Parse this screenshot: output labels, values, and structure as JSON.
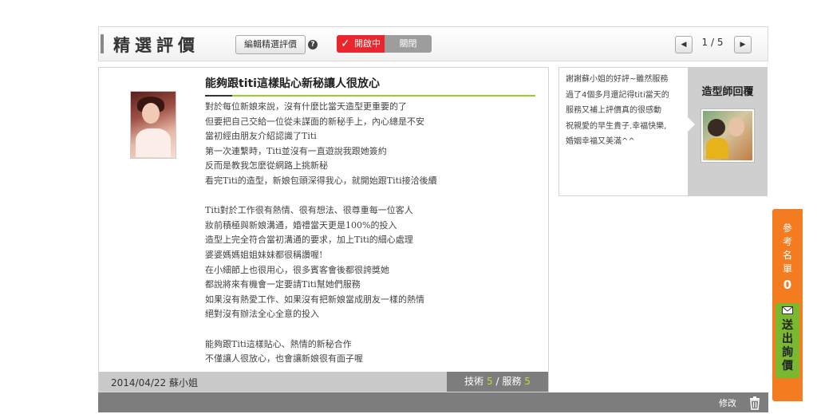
{
  "header": {
    "title": "精選評價",
    "edit_label": "編輯精選評價",
    "help": "?",
    "toggle_on": "開啟中",
    "toggle_off": "關閉",
    "pager": "1 / 5",
    "prev": "◀",
    "next": "▶"
  },
  "review": {
    "title": "能夠跟titi這樣貼心新秘讓人很放心",
    "lines": [
      "對於每位新娘來說，沒有什麼比當天造型更重要的了",
      "但要把自己交給一位從未謀面的新秘手上，內心總是不安",
      "當初經由朋友介紹認識了Titi",
      "第一次連繫時，Titi並沒有一直遊說我跟她簽約",
      "反而是教我怎麼從網路上挑新秘",
      "看完Titi的造型，新娘包頭深得我心，就開始跟Titi接洽後續",
      "",
      "Titi對於工作很有熱情、很有想法、很尊重每一位客人",
      "妝前積極與新娘溝通，婚禮當天更是100%的投入",
      "造型上完全符合當初溝通的要求，加上Titi的細心處理",
      "婆婆媽媽姐姐妹妹都很稱讚喔!",
      "在小細節上也很用心，很多賓客會後都很誇獎她",
      "都說將來有機會一定要請Titi幫她們服務",
      "如果沒有熱愛工作、如果沒有把新娘當成朋友一樣的熱情",
      "絕對沒有辦法全心全意的投入",
      "",
      "能夠跟Titi這樣貼心、熱情的新秘合作",
      "不僅讓人很放心，也會讓新娘很有面子喔"
    ],
    "date_author": "2014/04/22 蘇小姐",
    "skill_label": "技術",
    "skill_score": "5",
    "sep": "/",
    "service_label": "服務",
    "service_score": "5"
  },
  "reply": {
    "lines": [
      "謝謝蘇小姐的好評~雖然服務",
      "過了4個多月還記得titi當天的",
      "服務又補上評價真的很感動",
      "祝親愛的早生貴子.幸福快樂,",
      "婚姻幸福又美滿^^"
    ],
    "label": "造型師回覆"
  },
  "footer": {
    "edit": "修改"
  },
  "sidepanel": {
    "ref_label": "參考名單",
    "ref_count": "0",
    "inquiry": "送出詢價"
  }
}
